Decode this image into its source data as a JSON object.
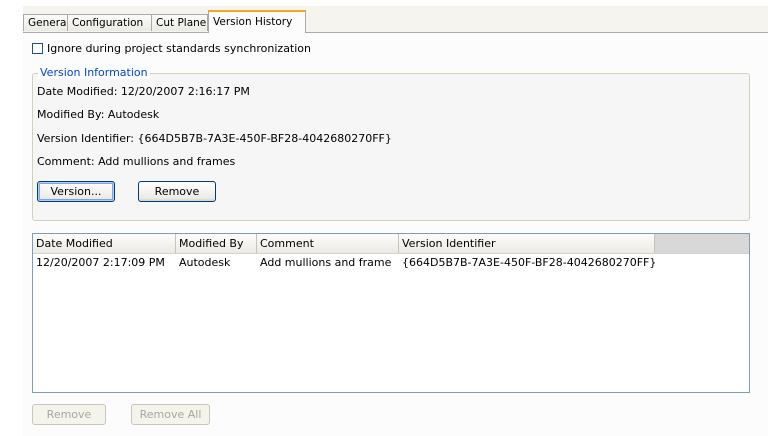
{
  "tabs": [
    {
      "label": "General"
    },
    {
      "label": "Configuration"
    },
    {
      "label": "Cut Plane"
    },
    {
      "label": "Version History",
      "active": true
    }
  ],
  "ignore_checkbox": {
    "label": "Ignore during project standards synchronization",
    "checked": false
  },
  "version_info": {
    "legend": "Version Information",
    "date_modified": "Date Modified: 12/20/2007 2:16:17 PM",
    "modified_by": "Modified By:  Autodesk",
    "version_identifier": "Version Identifier: {664D5B7B-7A3E-450F-BF28-4042680270FF}",
    "comment": "Comment: Add mullions and frames",
    "version_button": "Version...",
    "remove_button": "Remove"
  },
  "history_table": {
    "columns": [
      "Date Modified",
      "Modified By",
      "Comment",
      "Version Identifier"
    ],
    "rows": [
      [
        "12/20/2007 2:17:09 PM",
        "Autodesk",
        "Add mullions and frames",
        "{664D5B7B-7A3E-450F-BF28-4042680270FF}"
      ]
    ]
  },
  "footer": {
    "remove_button": "Remove",
    "remove_all_button": "Remove All"
  },
  "colors": {
    "active_tab_accent": "#f5a623",
    "legend_text": "#0046d5",
    "button_border": "#003c74",
    "disabled_text": "#a6a6a6"
  }
}
